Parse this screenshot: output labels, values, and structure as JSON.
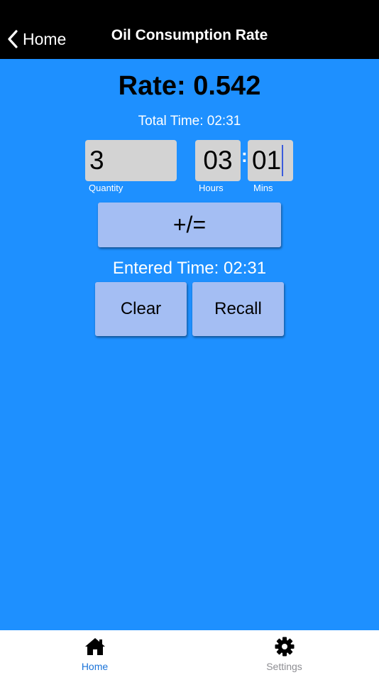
{
  "header": {
    "back_label": "Home",
    "title": "Oil Consumption Rate"
  },
  "main": {
    "rate_text": "Rate: 0.542",
    "total_time_text": "Total Time: 02:31",
    "quantity": {
      "value": "3",
      "caption": "Quantity"
    },
    "hours": {
      "value": "03",
      "caption": "Hours"
    },
    "time_separator": ":",
    "mins": {
      "value": "01",
      "caption": "Mins"
    },
    "plus_equals_label": "+/=",
    "entered_time_text": "Entered Time: 02:31",
    "clear_label": "Clear",
    "recall_label": "Recall"
  },
  "tab_bar": {
    "tabs": [
      {
        "label": "Home",
        "icon": "home-icon",
        "active": true
      },
      {
        "label": "Settings",
        "icon": "gear-icon",
        "active": false
      }
    ]
  },
  "colors": {
    "background": "#1E90FF",
    "nav_bar": "#000000",
    "input_box": "#D3D3D3",
    "button": "#A4BEF3",
    "active_tab": "#1A73D9",
    "inactive_tab": "#8E8E93"
  }
}
